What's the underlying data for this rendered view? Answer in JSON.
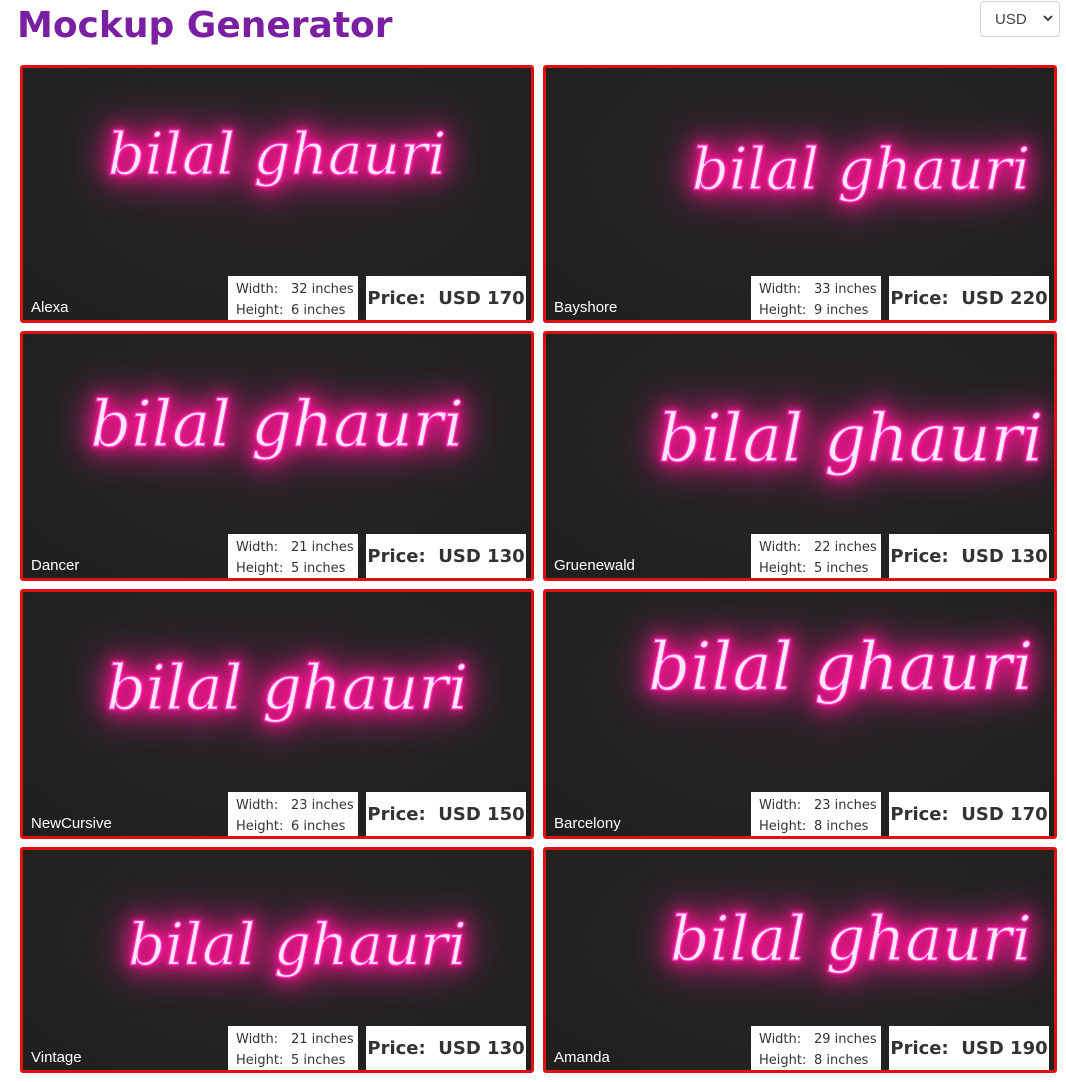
{
  "header": {
    "title": "Mockup Generator",
    "currency": "USD"
  },
  "labels": {
    "width": "Width:",
    "height": "Height:",
    "price": "Price:"
  },
  "neon_color": "#ff1493",
  "cards": [
    {
      "text": "bilal ghauri",
      "font": "Alexa",
      "width": "32 inches",
      "height": "6 inches",
      "price": "USD 170"
    },
    {
      "text": "bilal ghauri",
      "font": "Bayshore",
      "width": "33 inches",
      "height": "9 inches",
      "price": "USD 220"
    },
    {
      "text": "bilal ghauri",
      "font": "Dancer",
      "width": "21 inches",
      "height": "5 inches",
      "price": "USD 130"
    },
    {
      "text": "bilal ghauri",
      "font": "Gruenewald",
      "width": "22 inches",
      "height": "5 inches",
      "price": "USD 130"
    },
    {
      "text": "bilal ghauri",
      "font": "NewCursive",
      "width": "23 inches",
      "height": "6 inches",
      "price": "USD 150"
    },
    {
      "text": "bilal ghauri",
      "font": "Barcelony",
      "width": "23 inches",
      "height": "8 inches",
      "price": "USD 170"
    },
    {
      "text": "bilal ghauri",
      "font": "Vintage",
      "width": "21 inches",
      "height": "5 inches",
      "price": "USD 130"
    },
    {
      "text": "bilal ghauri",
      "font": "Amanda",
      "width": "29 inches",
      "height": "8 inches",
      "price": "USD 190"
    }
  ]
}
